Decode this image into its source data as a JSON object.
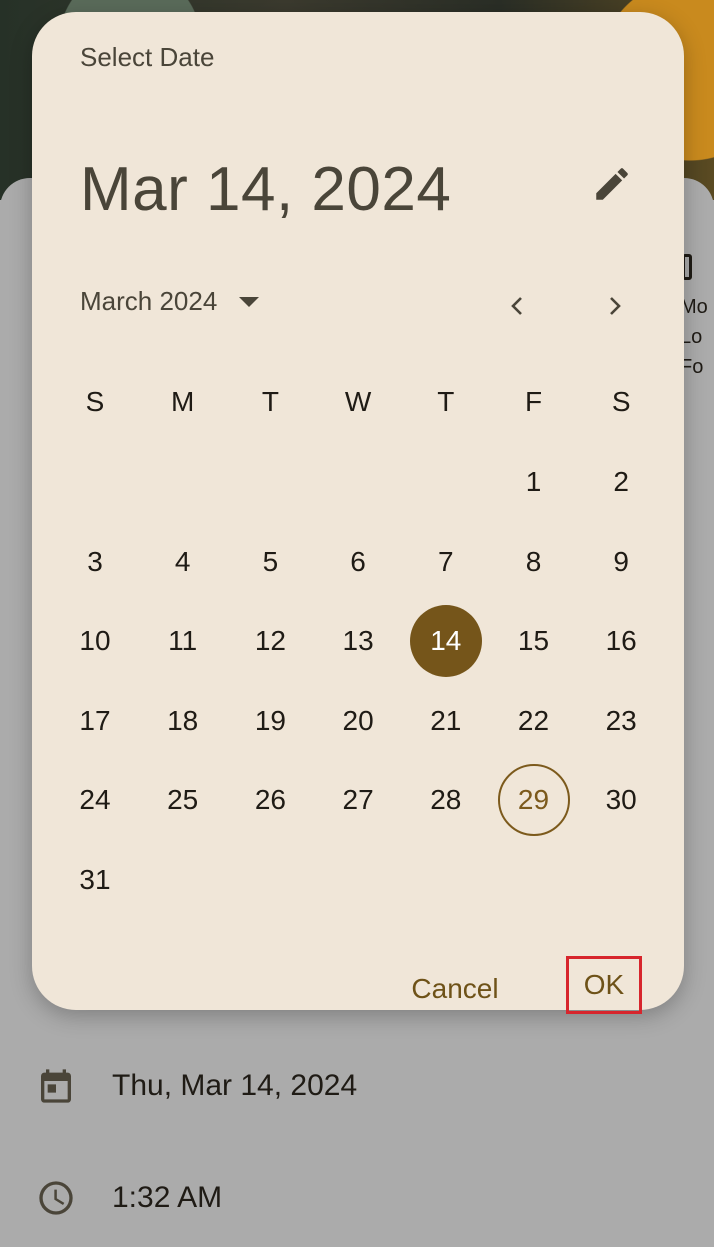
{
  "dialog": {
    "title": "Select Date",
    "selected_date_heading": "Mar 14, 2024",
    "month_label": "March 2024",
    "weekdays": [
      "S",
      "M",
      "T",
      "W",
      "T",
      "F",
      "S"
    ],
    "days": [
      "1",
      "2",
      "3",
      "4",
      "5",
      "6",
      "7",
      "8",
      "9",
      "10",
      "11",
      "12",
      "13",
      "14",
      "15",
      "16",
      "17",
      "18",
      "19",
      "20",
      "21",
      "22",
      "23",
      "24",
      "25",
      "26",
      "27",
      "28",
      "29",
      "30",
      "31"
    ],
    "first_weekday_index": 5,
    "selected_day": "14",
    "today_day": "29",
    "cancel_label": "Cancel",
    "ok_label": "OK",
    "colors": {
      "surface": "#f0e6d8",
      "accent": "#75551a",
      "highlight_box": "#d7252c"
    },
    "icons": [
      "edit-pencil-icon",
      "caret-down-icon",
      "chevron-left-icon",
      "chevron-right-icon"
    ]
  },
  "underlay": {
    "date_value": "Thu, Mar 14, 2024",
    "time_value": "1:32 AM",
    "peek_lines": [
      "Mo",
      "Lo",
      "Fo"
    ],
    "icons": [
      "calendar-icon",
      "clock-icon"
    ]
  }
}
